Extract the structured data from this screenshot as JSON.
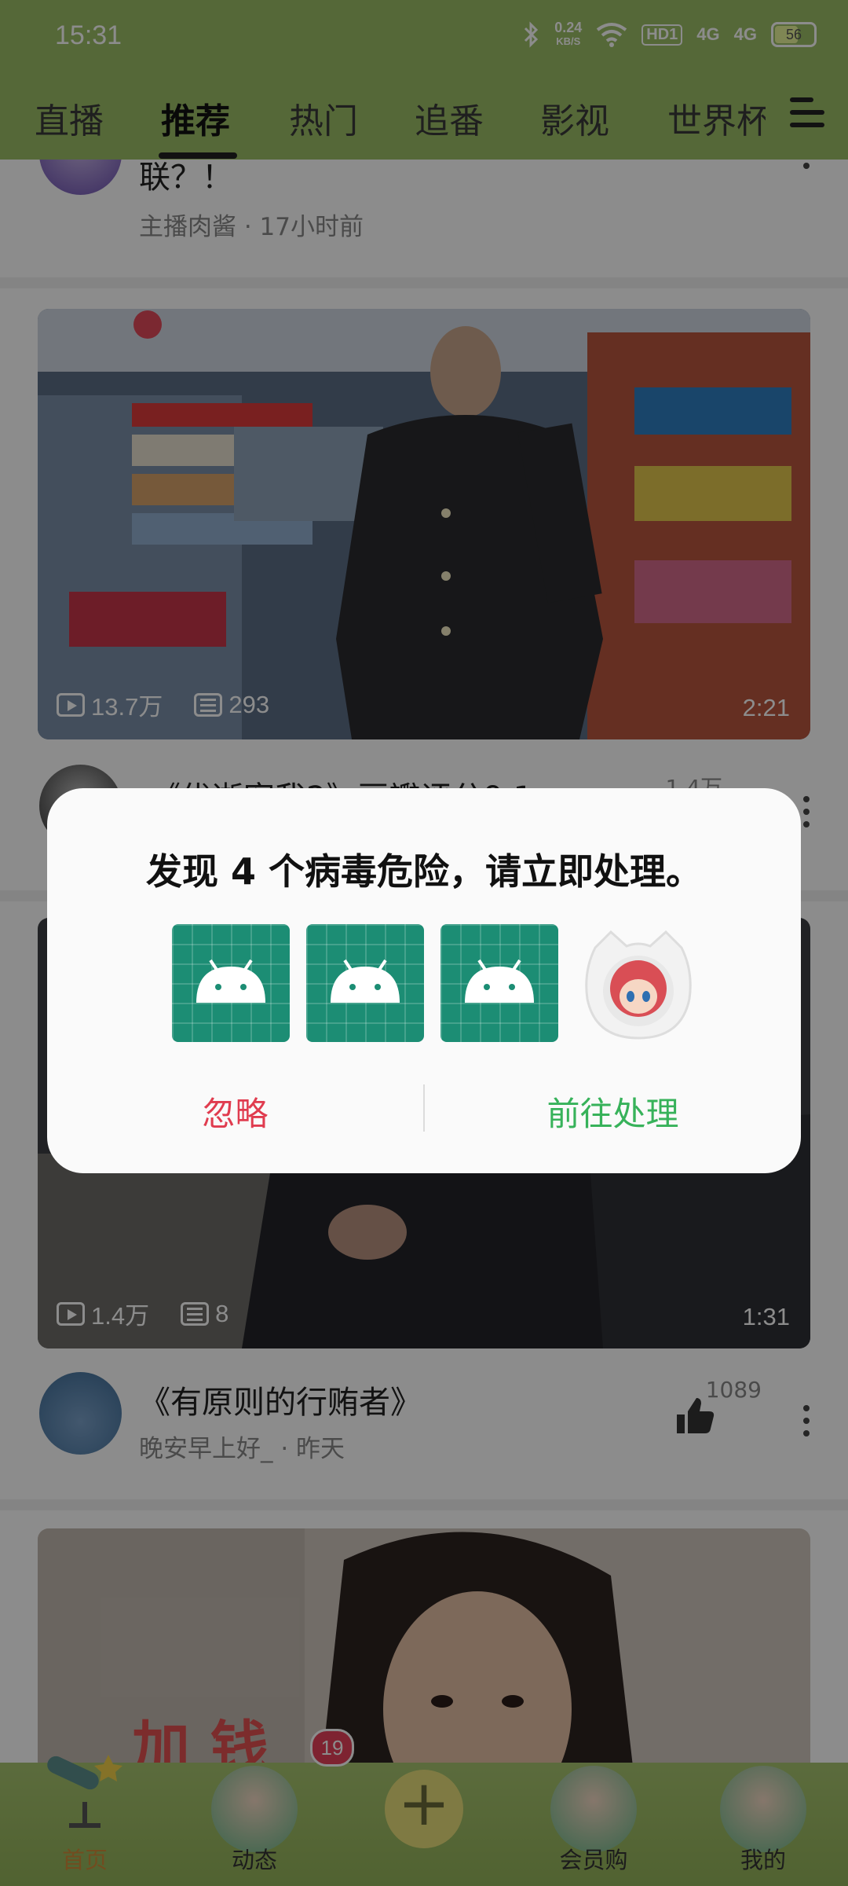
{
  "status_bar": {
    "time": "15:31",
    "speed_value": "0.24",
    "speed_unit": "KB/S",
    "hd_label": "HD1",
    "signal_1": "4G",
    "signal_2": "4G",
    "battery": "56",
    "icons": [
      "bluetooth-icon",
      "wifi-icon",
      "signal-icon",
      "battery-icon"
    ]
  },
  "tabs": [
    "直播",
    "推荐",
    "热门",
    "追番",
    "影视",
    "世界杯"
  ],
  "active_tab": "推荐",
  "feed": {
    "item0": {
      "title": "联？！",
      "subtitle": "主播肉酱 · 17小时前"
    },
    "video1": {
      "views": "13.7万",
      "danmaku": "293",
      "duration": "2:21"
    },
    "item1": {
      "title": "《优逝客我2》豆瓣评分9.1",
      "likes": "1.4万"
    },
    "video2": {
      "views": "1.4万",
      "danmaku": "8",
      "duration": "1:31"
    },
    "item2": {
      "title": "《有原则的行贿者》",
      "subtitle": "晚安早上好_ · 昨天",
      "likes": "1089"
    },
    "video3": {
      "overlay_text": "加 钱"
    }
  },
  "bottom_nav": {
    "items": [
      "首页",
      "动态",
      "会员购",
      "我的"
    ],
    "badge": "19",
    "plus": "+"
  },
  "dialog": {
    "title": "发现 4 个病毒危险，请立即处理。",
    "ignore": "忽略",
    "handle": "前往处理",
    "app_icons": [
      "android-app-icon",
      "android-app-icon",
      "android-app-icon",
      "anime-cat-app-icon"
    ]
  },
  "colors": {
    "header": "#9bbd66",
    "ignore": "#e03c4f",
    "handle": "#37b25a",
    "android_icon_bg": "#1c8d74"
  }
}
